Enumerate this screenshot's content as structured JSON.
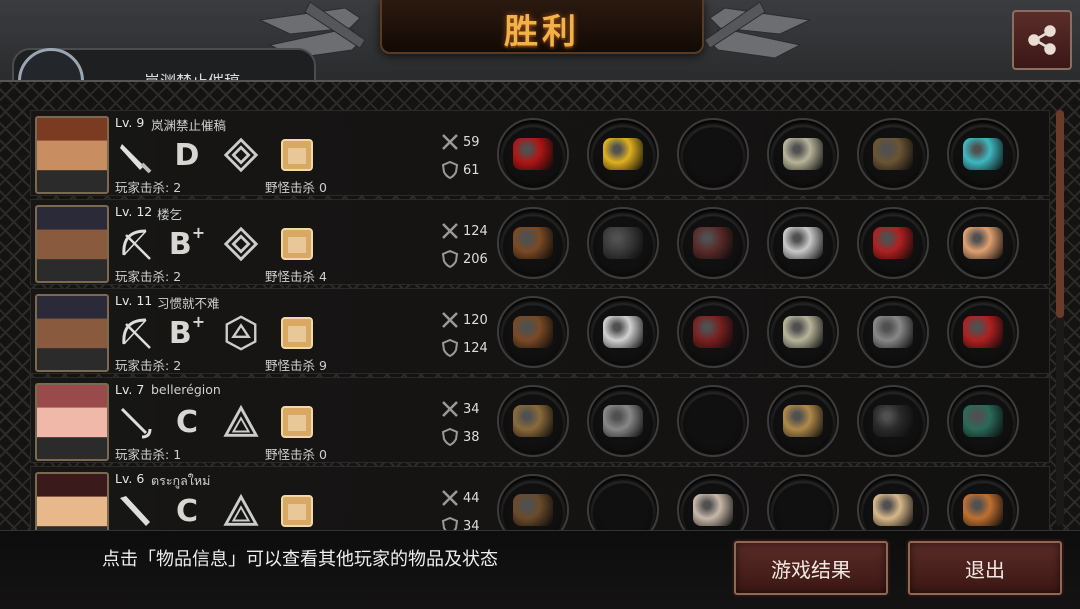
{
  "header": {
    "title": "胜利",
    "share_icon": "share-icon",
    "partial_player_name": "岚渊禁止催稿"
  },
  "labels": {
    "player_kills_prefix": "玩家击杀: ",
    "monster_kills_prefix": "野怪击杀 "
  },
  "players": [
    {
      "level": "Lv. 9",
      "name": "岚渊禁止催稿",
      "weapon_icon": "knife-icon",
      "grade": "D",
      "grade_plus": "",
      "rank_icon": "double-diamond-icon",
      "player_kills": "2",
      "monster_kills": "0",
      "attack": "59",
      "defense": "61",
      "items": [
        "red-cloth-item",
        "hard-hat-item",
        "empty-slot",
        "bracer-item",
        "boots-item",
        "eye-gem-item"
      ]
    },
    {
      "level": "Lv. 12",
      "name": "楼乞",
      "weapon_icon": "bow-icon",
      "grade": "B",
      "grade_plus": "+",
      "rank_icon": "double-diamond-icon",
      "player_kills": "2",
      "monster_kills": "4",
      "attack": "124",
      "defense": "206",
      "items": [
        "crossbow-item",
        "knight-helmet-item",
        "leather-jacket-item",
        "blade-bracer-item",
        "red-heels-item",
        "fan-item"
      ]
    },
    {
      "level": "Lv. 11",
      "name": "习惯就不难",
      "weapon_icon": "bow-icon",
      "grade": "B",
      "grade_plus": "+",
      "rank_icon": "hexagon-icon",
      "player_kills": "2",
      "monster_kills": "9",
      "attack": "120",
      "defense": "124",
      "items": [
        "crossbow-item",
        "glasses-item",
        "red-armor-item",
        "bracer-item",
        "chain-gloves-item",
        "red-quiver-item"
      ]
    },
    {
      "level": "Lv. 7",
      "name": "bellerégion",
      "weapon_icon": "rapier-icon",
      "grade": "C",
      "grade_plus": "",
      "rank_icon": "triangle-icon",
      "player_kills": "1",
      "monster_kills": "0",
      "attack": "34",
      "defense": "38",
      "items": [
        "spear-item",
        "headband-item",
        "empty-slot",
        "wristwatch-item",
        "black-boots-item",
        "baton-item"
      ]
    },
    {
      "level": "Lv. 6",
      "name": "ตระกูลใหม่",
      "weapon_icon": "bat-icon",
      "grade": "C",
      "grade_plus": "",
      "rank_icon": "triangle-icon",
      "player_kills": "",
      "monster_kills": "",
      "attack": "44",
      "defense": "34",
      "items": [
        "axe-item",
        "empty-slot",
        "robe-item",
        "empty-slot",
        "bone-item",
        "gourd-item"
      ]
    }
  ],
  "footer": {
    "hint": "点击「物品信息」可以查看其他玩家的物品及状态",
    "game_result_button": "游戏结果",
    "exit_button": "退出"
  },
  "colors": {
    "title_gold": "#f2b24a",
    "button_red": "#5a2b26",
    "scroll_thumb": "#6b3b2a"
  }
}
